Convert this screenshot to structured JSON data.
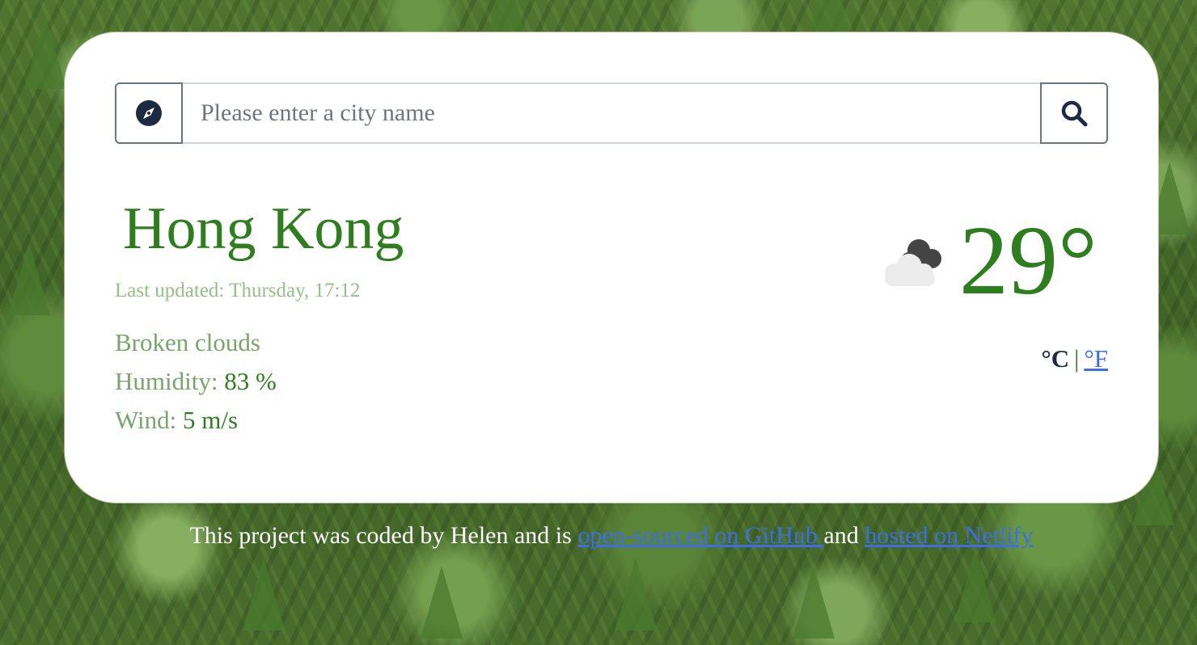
{
  "search": {
    "placeholder": "Please enter a city name",
    "value": "",
    "locate_icon": "compass-icon",
    "search_icon": "search-icon"
  },
  "weather": {
    "city": "Hong Kong",
    "last_updated": "Last updated: Thursday, 17:12",
    "description": "Broken clouds",
    "humidity_label": "Humidity: ",
    "humidity_value": "83 %",
    "wind_label": "Wind: ",
    "wind_value": "5 m/s",
    "temperature": "29°",
    "icon": "broken-clouds-icon"
  },
  "units": {
    "celsius": "°C",
    "separator": "|",
    "fahrenheit": "°F"
  },
  "footer": {
    "text_before": "This project was coded by Helen and is ",
    "github_link": "open-sourced on GitHub ",
    "text_middle": "and ",
    "netlify_link": "hosted on Netlify"
  },
  "colors": {
    "accent_green": "#2e7d1f",
    "link_blue": "#3b6ee8",
    "muted_green": "#76a668"
  }
}
